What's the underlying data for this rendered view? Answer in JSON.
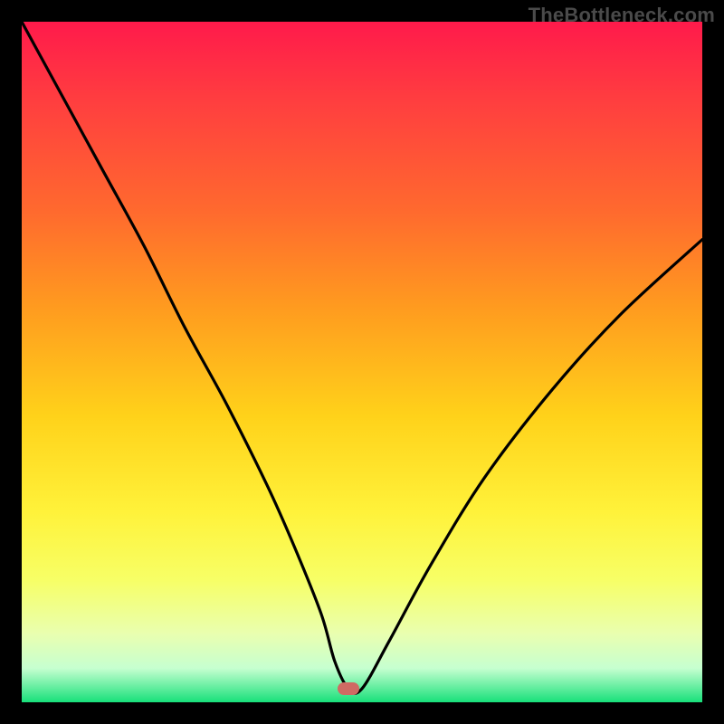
{
  "watermark": "TheBottleneck.com",
  "colors": {
    "frame": "#000000",
    "gradient_top": "#ff1a4b",
    "gradient_bottom": "#18e07a",
    "curve": "#000000",
    "marker": "#cf6a63"
  },
  "chart_data": {
    "type": "line",
    "title": "",
    "xlabel": "",
    "ylabel": "",
    "xlim": [
      0,
      100
    ],
    "ylim": [
      0,
      100
    ],
    "minimum": {
      "x": 48,
      "y": 2
    },
    "series": [
      {
        "name": "bottleneck-curve",
        "x": [
          0,
          6,
          12,
          18,
          24,
          30,
          36,
          40,
          44,
          46,
          48,
          50,
          54,
          60,
          68,
          78,
          88,
          100
        ],
        "values": [
          100,
          89,
          78,
          67,
          55,
          44,
          32,
          23,
          13,
          6,
          2,
          2,
          9,
          20,
          33,
          46,
          57,
          68
        ]
      }
    ]
  }
}
